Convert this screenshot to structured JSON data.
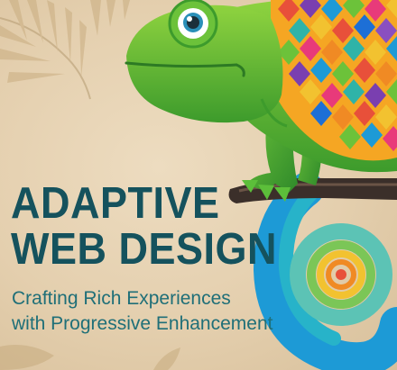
{
  "cover": {
    "title_line1": "ADAPTIVE",
    "title_line2": "WEB DESIGN",
    "subtitle_line1": "Crafting Rich Experiences",
    "subtitle_line2": "with Progressive Enhancement"
  },
  "colors": {
    "background": "#e4cfae",
    "title": "#15525d",
    "subtitle": "#1f6f78",
    "chameleon_green": "#5cbf3a",
    "branch": "#3b2f2a",
    "spiral_blue": "#1d9ad6"
  },
  "icons": [
    "chameleon-illustration",
    "palm-leaf-icon",
    "spiral-tail-icon",
    "branch-icon"
  ]
}
